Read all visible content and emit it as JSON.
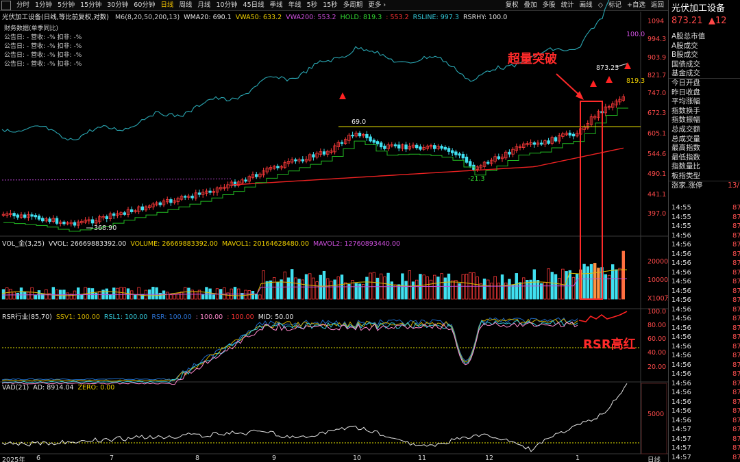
{
  "topbar": {
    "timeframes": [
      "分时",
      "1分钟",
      "5分钟",
      "15分钟",
      "30分钟",
      "60分钟",
      "日线",
      "周线",
      "月线",
      "10分钟",
      "45日线",
      "季线",
      "年线",
      "5秒",
      "15秒",
      "多周期",
      "更多"
    ],
    "active_timeframe": "日线",
    "tools": [
      "复权",
      "叠加",
      "多股",
      "统计",
      "画线",
      "标记",
      "+自选",
      "返回"
    ],
    "tool_icon": "diamond-icon"
  },
  "header": {
    "title": "光伏加工设备(日线,等比前复权,对数)",
    "indicators": [
      {
        "text": "M6(8,20,50,200,13)",
        "color": "#cfcfcf"
      },
      {
        "text": "WMA20: 690.1",
        "color": "#e6e6e6"
      },
      {
        "text": "VWA50: 633.2",
        "color": "#f0d000"
      },
      {
        "text": "VWA200: 553.2",
        "color": "#d050e0"
      },
      {
        "text": "HOLD: 819.3",
        "color": "#33dd33"
      },
      {
        "text": ": 553.2",
        "color": "#ff3333"
      },
      {
        "text": "RSLINE: 997.3",
        "color": "#33c8d8"
      },
      {
        "text": "RSRHY: 100.0",
        "color": "#e6e6e6"
      }
    ]
  },
  "financial": {
    "title": "财务数据(单季同比)",
    "rows": [
      "公告日: -   营收: -%   扣非: -%",
      "公告日: -   营收: -%   扣非: -%",
      "公告日: -   营收: -%   扣非: -%",
      "公告日: -   营收: -%   扣非: -%"
    ]
  },
  "price_axis": [
    "1094",
    "994.3",
    "903.9",
    "821.7",
    "747.0",
    "672.3",
    "605.1",
    "544.6",
    "490.1",
    "441.1",
    "397.0"
  ],
  "price_labels": {
    "high": "873.23",
    "low": "368.90",
    "peak": "69.0",
    "dip": "-21.3",
    "rs_top": "100.0",
    "hold": "819.3"
  },
  "vol_panel": {
    "labels": [
      {
        "text": "VOL_金(3,25)",
        "color": "#e6e6e6"
      },
      {
        "text": "VVOL: 26669883392.00",
        "color": "#e6e6e6"
      },
      {
        "text": "VOLUME: 26669883392.00",
        "color": "#f0d000"
      },
      {
        "text": "MAVOL1: 20164628480.00",
        "color": "#f0d000"
      },
      {
        "text": "MAVOL2: 12760893440.00",
        "color": "#d050e0"
      }
    ],
    "axis": [
      "20000",
      "10000",
      "X100万"
    ]
  },
  "rsr_panel": {
    "labels": [
      {
        "text": "RSR行业(85,70)",
        "color": "#e6e6e6"
      },
      {
        "text": "SSV1: 100.00",
        "color": "#d0b000"
      },
      {
        "text": "RSL1: 100.00",
        "color": "#33c8d8"
      },
      {
        "text": "RSR: 100.00",
        "color": "#2a70d0"
      },
      {
        "text": ": 100.00",
        "color": "#ff88cc"
      },
      {
        "text": ": 100.00",
        "color": "#ff3333"
      },
      {
        "text": "MID: 50.00",
        "color": "#e6e6e6"
      }
    ],
    "axis": [
      "100.0",
      "80.00",
      "60.00",
      "40.00",
      "20.00"
    ]
  },
  "vad_panel": {
    "labels": [
      {
        "text": "VAD(21)",
        "color": "#e6e6e6"
      },
      {
        "text": "AD: 8914.04",
        "color": "#e6e6e6"
      },
      {
        "text": "ZERO: 0.00",
        "color": "#f0d000"
      }
    ],
    "axis": [
      "5000"
    ]
  },
  "x_axis": {
    "year": "2025年",
    "months": [
      "6",
      "7",
      "8",
      "9",
      "10",
      "11",
      "12",
      "1"
    ],
    "period": "日线"
  },
  "annotations": {
    "breakout": "超量突破",
    "rsr": "RSR高红"
  },
  "right_panel": {
    "title": "光伏加工设备",
    "price": "873.21",
    "change": "▲12",
    "items": [
      "A股总市值",
      "A股成交",
      "B股成交",
      "国债成交",
      "基金成交",
      "今日开盘",
      "昨日收盘",
      "平均涨幅",
      "指数换手",
      "指数振幅",
      "总成交额",
      "总成交量",
      "最高指数",
      "最低指数",
      "指数量比",
      "板指类型",
      "涨家.涨停"
    ],
    "last_value": "13/",
    "times": [
      "14:55",
      "14:55",
      "14:55",
      "14:56",
      "14:56",
      "14:56",
      "14:56",
      "14:56",
      "14:56",
      "14:56",
      "14:56",
      "14:56",
      "14:56",
      "14:56",
      "14:56",
      "14:56",
      "14:56",
      "14:56",
      "14:56",
      "14:56",
      "14:56",
      "14:56",
      "14:56",
      "14:56",
      "14:57",
      "14:57",
      "14:57",
      "14:57",
      "14:57",
      "15:00"
    ],
    "time_price": "87"
  }
}
